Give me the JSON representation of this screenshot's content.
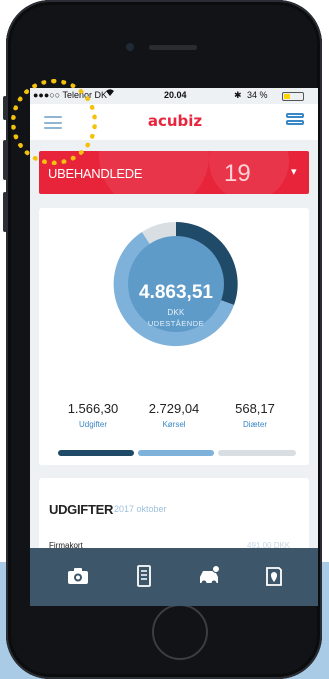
{
  "status_bar": {
    "carrier": "●●●○○ Telenor DK",
    "time": "20.04",
    "battery": "34 %",
    "battery_level_percent": 34
  },
  "app_bar": {
    "logo": "acubiz",
    "menu_icon": "hamburger-icon",
    "right_icon": "list-view-icon"
  },
  "pending_card": {
    "title": "UBEHANDLEDE",
    "count": "19",
    "chevron_icon": "chevron-down-icon",
    "color": "#e8243a"
  },
  "summary_card": {
    "total_value": "4.863,51",
    "currency": "DKK",
    "status": "UDESTÅENDE",
    "stats": [
      {
        "value": "1.566,30",
        "label": "Udgifter"
      },
      {
        "value": "2.729,04",
        "label": "Kørsel"
      },
      {
        "value": "568,17",
        "label": "Diæter"
      }
    ],
    "colors": {
      "udgifter": "#1f4a68",
      "korsel": "#7fb2da",
      "diaeter": "#d9dee3"
    }
  },
  "expenses_card": {
    "title": "UDGIFTER",
    "month": "2017 oktober",
    "rows": [
      {
        "label": "Firmakort",
        "value": "491,00 DKK"
      }
    ]
  },
  "tab_bar": {
    "tabs": [
      {
        "name": "camera",
        "icon": "camera-icon"
      },
      {
        "name": "receipt",
        "icon": "receipt-icon"
      },
      {
        "name": "mileage",
        "icon": "car-icon"
      },
      {
        "name": "allowance",
        "icon": "map-pin-icon"
      }
    ]
  },
  "highlight": {
    "color": "#f4c20d",
    "target": "hamburger-icon"
  }
}
